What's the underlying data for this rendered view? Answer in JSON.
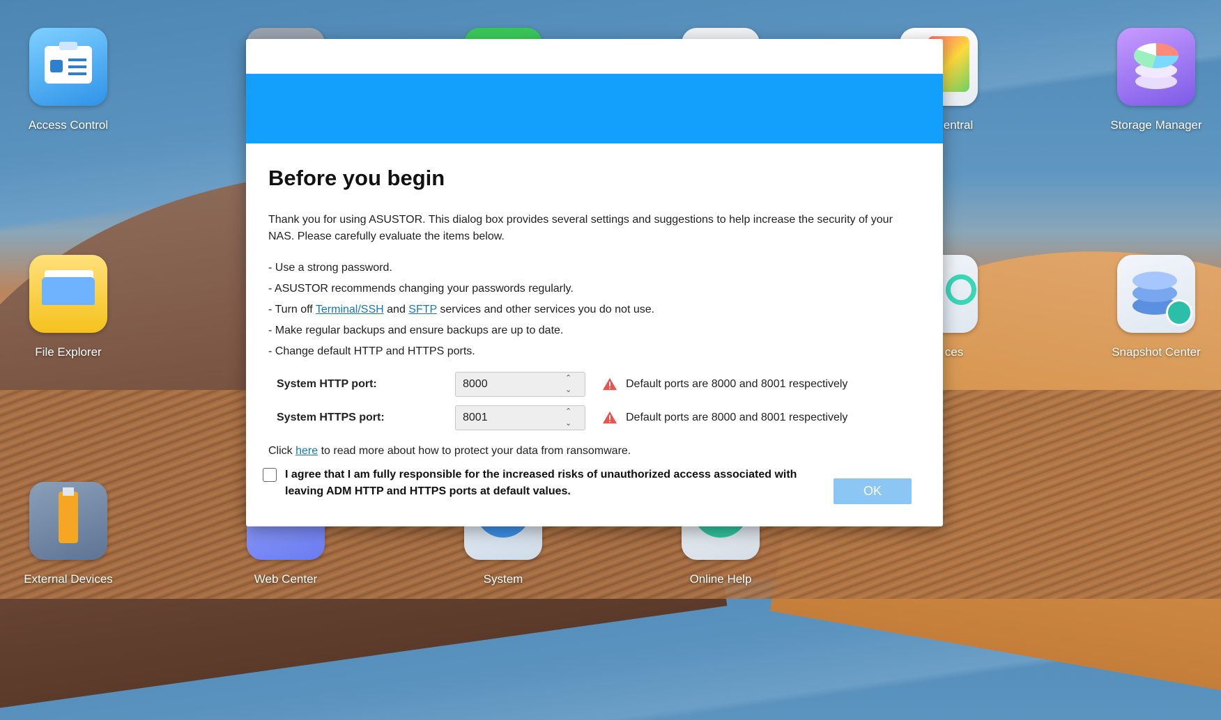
{
  "desktop": {
    "apps": [
      {
        "label": "Access Control",
        "icon": "access-control-icon"
      },
      {
        "label": "Storage Manager",
        "icon": "storage-manager-icon"
      },
      {
        "label": "File Explorer",
        "icon": "file-explorer-icon"
      },
      {
        "label": "Snapshot Center",
        "icon": "snapshot-center-icon"
      },
      {
        "label": "External Devices",
        "icon": "external-devices-icon"
      },
      {
        "label": "Web Center",
        "icon": "web-center-icon"
      },
      {
        "label": "System",
        "icon": "system-info-icon"
      },
      {
        "label": "Online Help",
        "icon": "online-help-icon"
      },
      {
        "label": "entral",
        "icon": "app-central-icon"
      },
      {
        "label": "ces",
        "icon": "services-icon"
      }
    ]
  },
  "dialog": {
    "title": "Before you begin",
    "intro": "Thank you for using ASUSTOR. This dialog box provides several settings and suggestions to help increase the security of your NAS. Please carefully evaluate the items below.",
    "tips": {
      "t1": "- Use a strong password.",
      "t2": "- ASUSTOR recommends changing your passwords regularly.",
      "t3_prefix": "- Turn off ",
      "t3_link1": "Terminal/SSH",
      "t3_mid": " and ",
      "t3_link2": "SFTP",
      "t3_suffix": " services and other services you do not use.",
      "t4": "- Make regular backups and ensure backups are up to date.",
      "t5": "- Change default HTTP and HTTPS ports."
    },
    "http_port": {
      "label": "System HTTP port:",
      "value": "8000",
      "warning": "Default ports are 8000 and 8001 respectively"
    },
    "https_port": {
      "label": "System HTTPS port:",
      "value": "8001",
      "warning": "Default ports are 8000 and 8001 respectively"
    },
    "ransom": {
      "prefix": "Click ",
      "link": "here",
      "suffix": " to read more about how to protect your data from ransomware."
    },
    "agree_text": "I agree that I am fully responsible for the increased risks of unauthorized access associated with leaving ADM HTTP and HTTPS ports at default values.",
    "agree_checked": false,
    "ok_label": "OK"
  },
  "colors": {
    "banner": "#12a0fc",
    "ok_button": "#8cc6f5",
    "link": "#1578b8",
    "warning": "#e8534f"
  }
}
